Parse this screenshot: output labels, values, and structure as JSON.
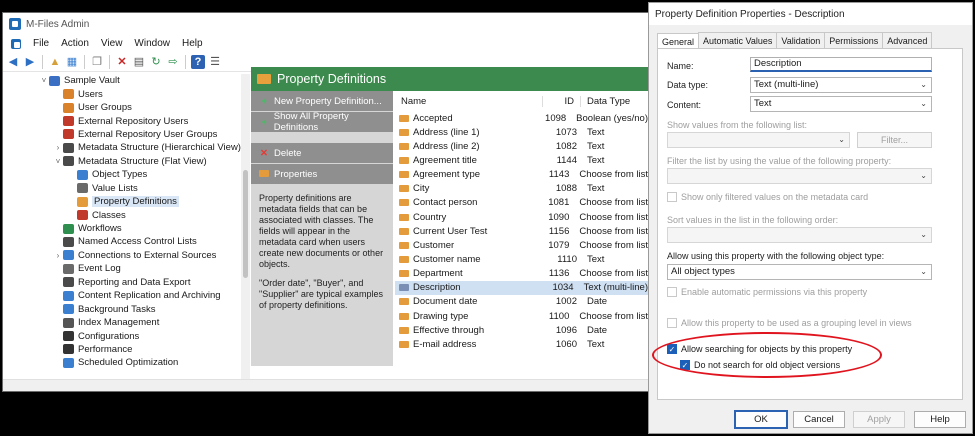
{
  "main": {
    "title": "M-Files Admin",
    "menu": [
      "File",
      "Action",
      "View",
      "Window",
      "Help"
    ],
    "tree": [
      {
        "label": "Sample Vault",
        "level": 0,
        "expander": "open",
        "icon": "vault-icon",
        "color": "#3a6fc4"
      },
      {
        "label": "Users",
        "level": 1,
        "expander": "",
        "icon": "user-icon",
        "color": "#d9822b"
      },
      {
        "label": "User Groups",
        "level": 1,
        "expander": "",
        "icon": "user-group-icon",
        "color": "#d9822b"
      },
      {
        "label": "External Repository Users",
        "level": 1,
        "expander": "",
        "icon": "external-user-icon",
        "color": "#c0392b"
      },
      {
        "label": "External Repository User Groups",
        "level": 1,
        "expander": "",
        "icon": "external-group-icon",
        "color": "#c0392b"
      },
      {
        "label": "Metadata Structure (Hierarchical View)",
        "level": 1,
        "expander": "closed",
        "icon": "metadata-icon",
        "color": "#4a4a4a"
      },
      {
        "label": "Metadata Structure (Flat View)",
        "level": 1,
        "expander": "open",
        "icon": "metadata-icon",
        "color": "#4a4a4a"
      },
      {
        "label": "Object Types",
        "level": 2,
        "expander": "",
        "icon": "object-types-icon",
        "color": "#3b7fd1"
      },
      {
        "label": "Value Lists",
        "level": 2,
        "expander": "",
        "icon": "value-list-icon",
        "color": "#6a6a6a"
      },
      {
        "label": "Property Definitions",
        "level": 2,
        "expander": "",
        "icon": "property-icon",
        "color": "#e39b3b",
        "selected": true
      },
      {
        "label": "Classes",
        "level": 2,
        "expander": "",
        "icon": "class-icon",
        "color": "#c0392b"
      },
      {
        "label": "Workflows",
        "level": 1,
        "expander": "",
        "icon": "workflow-icon",
        "color": "#2f8f4e"
      },
      {
        "label": "Named Access Control Lists",
        "level": 1,
        "expander": "",
        "icon": "acl-icon",
        "color": "#4a4a4a"
      },
      {
        "label": "Connections to External Sources",
        "level": 1,
        "expander": "closed",
        "icon": "connection-icon",
        "color": "#3b7fd1"
      },
      {
        "label": "Event Log",
        "level": 1,
        "expander": "",
        "icon": "event-log-icon",
        "color": "#6a6a6a"
      },
      {
        "label": "Reporting and Data Export",
        "level": 1,
        "expander": "",
        "icon": "report-icon",
        "color": "#4a4a4a"
      },
      {
        "label": "Content Replication and Archiving",
        "level": 1,
        "expander": "",
        "icon": "replication-icon",
        "color": "#3b7fd1"
      },
      {
        "label": "Background Tasks",
        "level": 1,
        "expander": "",
        "icon": "background-task-icon",
        "color": "#3b7fd1"
      },
      {
        "label": "Index Management",
        "level": 1,
        "expander": "",
        "icon": "index-icon",
        "color": "#555555"
      },
      {
        "label": "Configurations",
        "level": 1,
        "expander": "",
        "icon": "gear-icon",
        "color": "#333333"
      },
      {
        "label": "Performance",
        "level": 1,
        "expander": "",
        "icon": "performance-icon",
        "color": "#333333"
      },
      {
        "label": "Scheduled Optimization",
        "level": 1,
        "expander": "",
        "icon": "schedule-icon",
        "color": "#3b7fd1"
      }
    ],
    "header": "Property Definitions",
    "tasks": [
      {
        "icon": "+",
        "label": "New Property Definition..."
      },
      {
        "icon": "+",
        "label": "Show All Property Definitions"
      },
      {
        "icon": "x",
        "label": "Delete"
      },
      {
        "icon": "props",
        "label": "Properties"
      }
    ],
    "description_1": "Property definitions are metadata fields that can be associated with classes. The fields will appear in the metadata card when users create new documents or other objects.",
    "description_2": "\"Order date\", \"Buyer\", and \"Supplier\" are typical examples of property definitions.",
    "columns": [
      "Name",
      "ID",
      "Data Type"
    ],
    "rows": [
      {
        "name": "Accepted",
        "id": "1098",
        "type": "Boolean (yes/no)"
      },
      {
        "name": "Address (line 1)",
        "id": "1073",
        "type": "Text"
      },
      {
        "name": "Address (line 2)",
        "id": "1082",
        "type": "Text"
      },
      {
        "name": "Agreement title",
        "id": "1144",
        "type": "Text"
      },
      {
        "name": "Agreement type",
        "id": "1143",
        "type": "Choose from list"
      },
      {
        "name": "City",
        "id": "1088",
        "type": "Text"
      },
      {
        "name": "Contact person",
        "id": "1081",
        "type": "Choose from list"
      },
      {
        "name": "Country",
        "id": "1090",
        "type": "Choose from list"
      },
      {
        "name": "Current User Test",
        "id": "1156",
        "type": "Choose from list"
      },
      {
        "name": "Customer",
        "id": "1079",
        "type": "Choose from list"
      },
      {
        "name": "Customer name",
        "id": "1110",
        "type": "Text"
      },
      {
        "name": "Department",
        "id": "1136",
        "type": "Choose from list"
      },
      {
        "name": "Description",
        "id": "1034",
        "type": "Text (multi-line)",
        "selected": true
      },
      {
        "name": "Document date",
        "id": "1002",
        "type": "Date"
      },
      {
        "name": "Drawing type",
        "id": "1100",
        "type": "Choose from list"
      },
      {
        "name": "Effective through",
        "id": "1096",
        "type": "Date"
      },
      {
        "name": "E-mail address",
        "id": "1060",
        "type": "Text"
      }
    ]
  },
  "dialog": {
    "title": "Property Definition Properties - Description",
    "tabs": [
      "General",
      "Automatic Values",
      "Validation",
      "Permissions",
      "Advanced"
    ],
    "name_label": "Name:",
    "name_value": "Description",
    "datatype_label": "Data type:",
    "datatype_value": "Text (multi-line)",
    "content_label": "Content:",
    "content_value": "Text",
    "show_values_label": "Show values from the following list:",
    "filter_button": "Filter...",
    "filter_prop_label": "Filter the list by using the value of the following property:",
    "show_filtered_label": "Show only filtered values on the metadata card",
    "sort_label": "Sort values in the list in the following order:",
    "allow_objtype_label": "Allow using this property with the following object type:",
    "objtype_value": "All object types",
    "auto_perm_label": "Enable automatic permissions via this property",
    "grouping_label": "Allow this property to be used as a grouping level in views",
    "allow_search_label": "Allow searching for objects by this property",
    "no_old_label": "Do not search for old object versions",
    "buttons": {
      "ok": "OK",
      "cancel": "Cancel",
      "apply": "Apply",
      "help": "Help"
    }
  },
  "accent": {
    "highlight_ring": "#e0141e",
    "header_green": "#3c8a4d"
  }
}
